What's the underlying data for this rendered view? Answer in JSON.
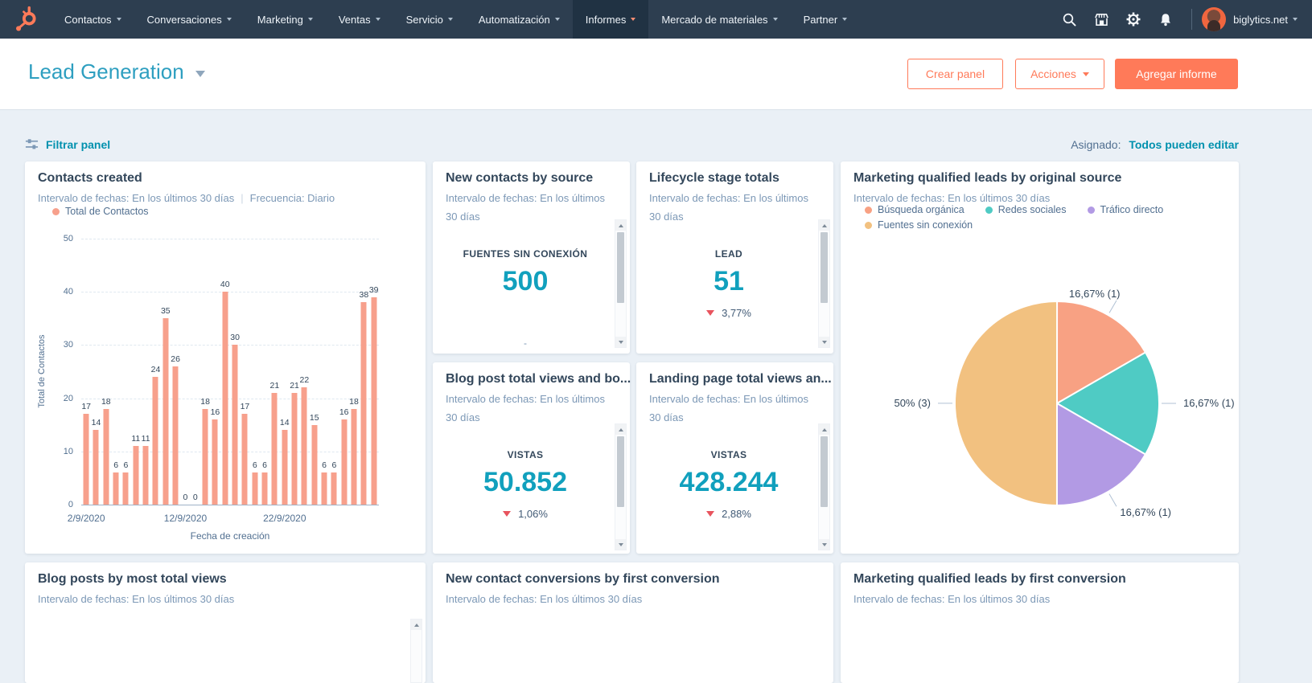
{
  "nav": {
    "brand": "HubSpot",
    "items": [
      {
        "label": "Contactos"
      },
      {
        "label": "Conversaciones"
      },
      {
        "label": "Marketing"
      },
      {
        "label": "Ventas"
      },
      {
        "label": "Servicio"
      },
      {
        "label": "Automatización"
      },
      {
        "label": "Informes",
        "active": true
      },
      {
        "label": "Mercado de materiales"
      },
      {
        "label": "Partner"
      }
    ],
    "account": "biglytics.net"
  },
  "header": {
    "title": "Lead Generation",
    "create_panel_label": "Crear panel",
    "actions_label": "Acciones",
    "add_report_label": "Agregar informe"
  },
  "toolbar": {
    "filter_label": "Filtrar panel",
    "assigned_label": "Asignado:",
    "assigned_value": "Todos pueden editar"
  },
  "colors": {
    "brand_orange": "#ff7a59",
    "bar_orange": "#f7a08c",
    "stat_teal": "#11a0bd",
    "link_teal": "#0091ae",
    "negative_red": "#e8545e",
    "nav_bg": "#2d3e50"
  },
  "cards": {
    "contacts_created": {
      "title": "Contacts created",
      "subtitle_range": "Intervalo de fechas: En los últimos 30 días",
      "subtitle_freq": "Frecuencia: Diario",
      "legend": "Total de Contactos"
    },
    "new_contacts_by_source": {
      "title": "New contacts by source",
      "subtitle": "Intervalo de fechas: En los últimos 30 días",
      "stat_label": "FUENTES SIN CONEXIÓN",
      "stat_value": "500",
      "more_indicator": "-"
    },
    "lifecycle_stage_totals": {
      "title": "Lifecycle stage totals",
      "subtitle": "Intervalo de fechas: En los últimos 30 días",
      "stat_label": "LEAD",
      "stat_value": "51",
      "delta": "3,77%",
      "delta_direction": "down"
    },
    "mql_by_original_source": {
      "title": "Marketing qualified leads by original source",
      "subtitle": "Intervalo de fechas: En los últimos 30 días"
    },
    "blog_post_views": {
      "title": "Blog post total views and bo...",
      "subtitle": "Intervalo de fechas: En los últimos 30 días",
      "stat_label": "VISTAS",
      "stat_value": "50.852",
      "delta": "1,06%",
      "delta_direction": "down"
    },
    "landing_page_views": {
      "title": "Landing page total views an...",
      "subtitle": "Intervalo de fechas: En los últimos 30 días",
      "stat_label": "VISTAS",
      "stat_value": "428.244",
      "delta": "2,88%",
      "delta_direction": "down"
    },
    "blog_posts_by_views": {
      "title": "Blog posts by most total views",
      "subtitle": "Intervalo de fechas: En los últimos 30 días"
    },
    "new_contact_conversions": {
      "title": "New contact conversions by first conversion",
      "subtitle": "Intervalo de fechas: En los últimos 30 días"
    },
    "mql_by_first_conversion": {
      "title": "Marketing qualified leads by first conversion",
      "subtitle": "Intervalo de fechas: En los últimos 30 días"
    }
  },
  "chart_data": [
    {
      "id": "contacts_created",
      "type": "bar",
      "title": "Contacts created",
      "series_name": "Total de Contactos",
      "values": [
        17,
        14,
        18,
        6,
        6,
        11,
        11,
        24,
        35,
        26,
        0,
        0,
        18,
        16,
        40,
        30,
        17,
        6,
        6,
        21,
        14,
        21,
        22,
        15,
        6,
        6,
        16,
        18,
        38,
        39
      ],
      "x_tick_labels": [
        {
          "index": 0,
          "label": "2/9/2020"
        },
        {
          "index": 10,
          "label": "12/9/2020"
        },
        {
          "index": 20,
          "label": "22/9/2020"
        }
      ],
      "xlabel": "Fecha de creación",
      "ylabel": "Total de Contactos",
      "ylim": [
        0,
        50
      ],
      "yticks": [
        0,
        10,
        20,
        30,
        40,
        50
      ],
      "grid": "dashed-horizontal",
      "bar_color": "#f7a08c",
      "legend_position": "top-left"
    },
    {
      "id": "mql_by_original_source",
      "type": "pie",
      "title": "Marketing qualified leads by original source",
      "start_angle_deg_from_12": 0,
      "direction": "clockwise",
      "legend_position": "top",
      "slices": [
        {
          "name": "Búsqueda orgánica",
          "value": 1,
          "percent": 16.67,
          "label": "16,67% (1)",
          "color": "#f8a183"
        },
        {
          "name": "Redes sociales",
          "value": 1,
          "percent": 16.67,
          "label": "16,67% (1)",
          "color": "#4fcbc4"
        },
        {
          "name": "Tráfico directo",
          "value": 1,
          "percent": 16.67,
          "label": "16,67% (1)",
          "color": "#b29ae4"
        },
        {
          "name": "Fuentes sin conexión",
          "value": 3,
          "percent": 50,
          "label": "50% (3)",
          "color": "#f2c180"
        }
      ]
    }
  ]
}
